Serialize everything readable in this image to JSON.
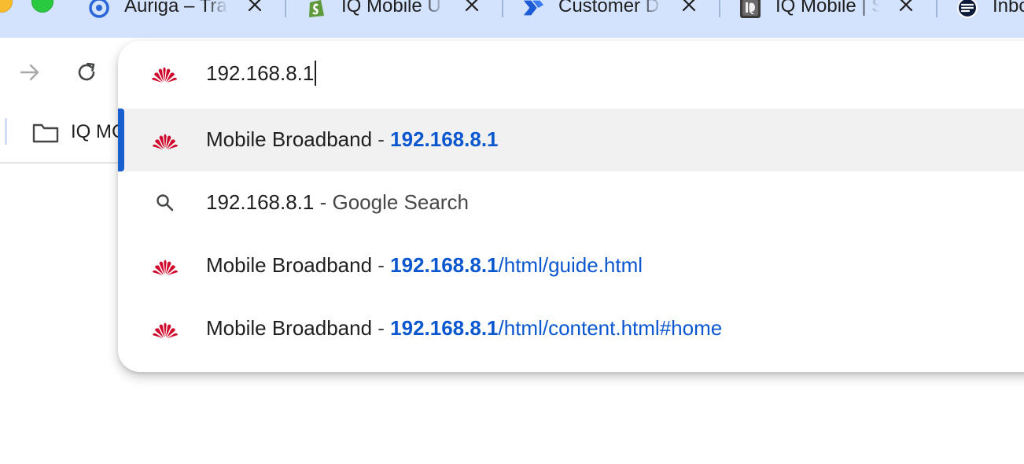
{
  "window": {
    "traffic_light_colors": {
      "minimize": "#f7bd2e",
      "maximize": "#29c940"
    }
  },
  "tabs": [
    {
      "title": "Auriga – Tra",
      "icon": "auriga-ring-icon"
    },
    {
      "title": "IQ Mobile U",
      "icon": "shopify-bag-icon"
    },
    {
      "title": "Customer D",
      "icon": "blue-chevron-logo-icon"
    },
    {
      "title": "IQ Mobile | S",
      "icon": "iq-mobile-logo-icon"
    },
    {
      "title": "Inbo",
      "icon": "mail-app-icon"
    }
  ],
  "toolbar": {
    "forward_icon": "forward-arrow-icon",
    "reload_icon": "reload-icon"
  },
  "bookmarks": {
    "items": [
      {
        "label": "IQ MC",
        "icon": "folder-icon"
      }
    ]
  },
  "omnibox": {
    "input_value": "192.168.8.1",
    "input_icon": "huawei-logo-icon",
    "suggestions": [
      {
        "icon": "huawei-logo-icon",
        "title": "Mobile Broadband",
        "sep": " - ",
        "url_bold": "192.168.8.1",
        "url_rest": "",
        "selected": true
      },
      {
        "icon": "search-icon",
        "query": "192.168.8.1",
        "sep": " - ",
        "engine": "Google Search",
        "selected": false
      },
      {
        "icon": "huawei-logo-icon",
        "title": "Mobile Broadband",
        "sep": " - ",
        "url_bold": "192.168.8.1",
        "url_rest": "/html/guide.html",
        "selected": false
      },
      {
        "icon": "huawei-logo-icon",
        "title": "Mobile Broadband",
        "sep": " - ",
        "url_bold": "192.168.8.1",
        "url_rest": "/html/content.html#home",
        "selected": false
      }
    ],
    "colors": {
      "url": "#0b57d0",
      "selection_bar": "#1a5fd0",
      "selected_bg": "#f1f1f1"
    }
  }
}
